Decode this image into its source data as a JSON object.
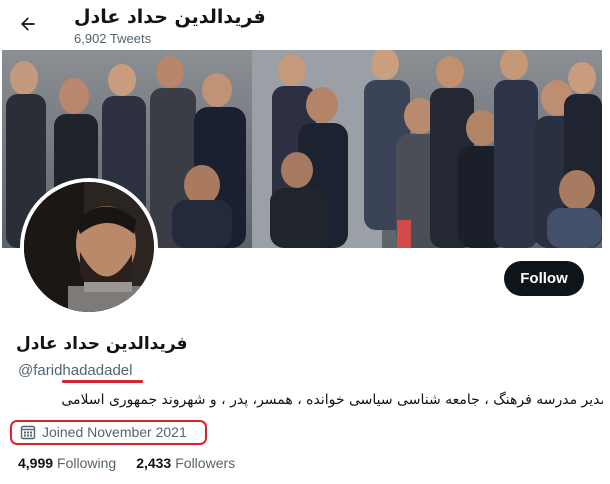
{
  "header": {
    "title": "فریدالدین حداد عادل",
    "tweets": "6,902 Tweets",
    "back_icon": "arrow-left-icon"
  },
  "profile": {
    "follow_label": "Follow",
    "display_name": "فریدالدین حداد عادل",
    "handle": "@faridhadadadel",
    "bio": "مدیر مدرسه فرهنگ ، جامعه شناسی سیاسی خوانده ، همسر، پدر ، و شهروند جمهوری اسلامی",
    "joined": "Joined November 2021",
    "joined_icon": "calendar-icon",
    "following_count": "4,999",
    "following_label": "Following",
    "followers_count": "2,433",
    "followers_label": "Followers"
  },
  "colors": {
    "annotation_red": "#d4252b",
    "follow_bg": "#0f1419",
    "secondary_text": "#536471"
  }
}
